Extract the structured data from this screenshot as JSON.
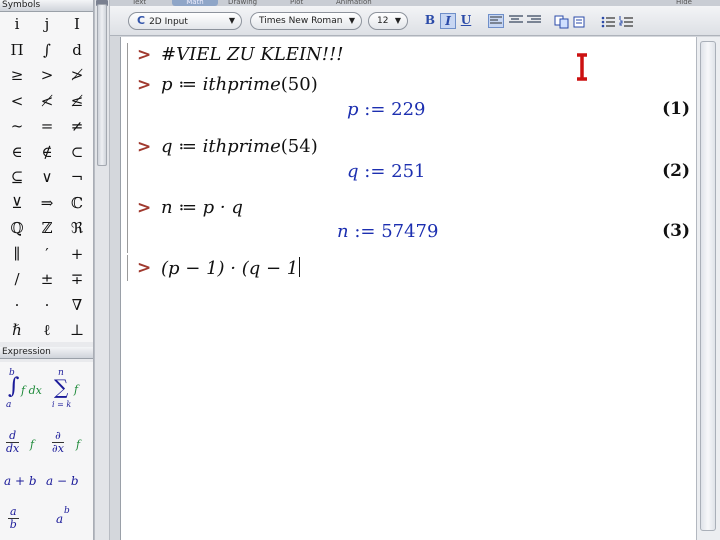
{
  "palette": {
    "symbols_title": "Symbols",
    "symbols": [
      "i",
      "j",
      "I",
      "Π",
      "∫",
      "d",
      "≥",
      ">",
      "≯",
      "<",
      "≮",
      "≰",
      "~",
      "=",
      "≠",
      "∈",
      "∉",
      "⊂",
      "⊆",
      "∨",
      "¬",
      "⊻",
      "⇒",
      "ℂ",
      "ℚ",
      "ℤ",
      "ℜ",
      "∥",
      "′",
      "+",
      "/",
      "±",
      "∓",
      "·",
      "·",
      "∇",
      "ℏ",
      "ℓ",
      "⊥"
    ],
    "expression_title": "Expression",
    "expressions": {
      "integral": {
        "a": "a",
        "b": "b",
        "body": "f dx"
      },
      "sum": {
        "top": "n",
        "bottom": "i = k",
        "body": "f"
      },
      "derivative": {
        "num": "d",
        "den": "dx",
        "body": "f"
      },
      "partial": {
        "num": "∂",
        "den": "∂x",
        "body": "f"
      },
      "plus": "a + b",
      "minus": "a − b",
      "fraction": {
        "num": "a",
        "den": "b"
      },
      "power": {
        "base": "a",
        "exp": "b"
      }
    }
  },
  "tabs": [
    "Text",
    "Math",
    "Drawing",
    "Plot",
    "Animation",
    "Hide"
  ],
  "toolbar": {
    "input_mode": "2D Input",
    "input_mode_glyph": "C",
    "font": "Times New Roman",
    "font_size": "12",
    "bold": "B",
    "italic": "I",
    "underline": "U"
  },
  "worksheet": {
    "prompt": ">",
    "lines": [
      {
        "input": "#VIEL ZU KLEIN!!!"
      },
      {
        "input_var": "p",
        "assign": " ≔ ",
        "call": "ithprime",
        "arg": "(50)",
        "out_var": "p",
        "out_assign": " := ",
        "out_value": "229",
        "label": "(1)"
      },
      {
        "input_var": "q",
        "assign": " ≔ ",
        "call": "ithprime",
        "arg": "(54)",
        "out_var": "q",
        "out_assign": " := ",
        "out_value": "251",
        "label": "(2)"
      },
      {
        "input_var": "n",
        "assign": " ≔ ",
        "expr": "p · q",
        "out_var": "n",
        "out_assign": " := ",
        "out_value": "57479",
        "label": "(3)"
      },
      {
        "input": "(p − 1) · (q − 1"
      }
    ]
  },
  "colors": {
    "prompt": "#a0392e",
    "output": "#1c2fb0",
    "cursor": "#cc1111"
  }
}
